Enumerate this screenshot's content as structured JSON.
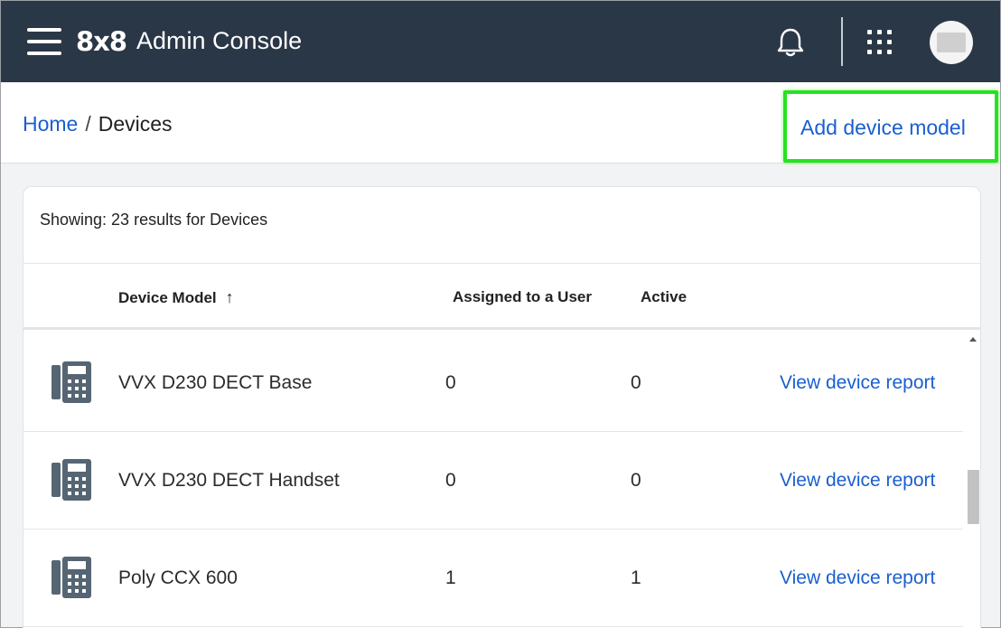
{
  "header": {
    "logo": "8x8",
    "title": "Admin Console",
    "icons": [
      "menu-icon",
      "bell-icon",
      "apps-grid-icon",
      "avatar"
    ]
  },
  "breadcrumb": {
    "home": "Home",
    "separator": "/",
    "current": "Devices"
  },
  "actions": {
    "add_device_model": "Add device model"
  },
  "results": {
    "showing": "Showing: 23 results for Devices"
  },
  "table": {
    "columns": {
      "device_model": "Device Model",
      "sort_indicator": "↑",
      "assigned": "Assigned to a User",
      "active": "Active"
    },
    "rows": [
      {
        "model": "VVX D230 DECT Base",
        "assigned": "0",
        "active": "0",
        "action": "View device report"
      },
      {
        "model": "VVX D230 DECT Handset",
        "assigned": "0",
        "active": "0",
        "action": "View device report"
      },
      {
        "model": "Poly CCX 600",
        "assigned": "1",
        "active": "1",
        "action": "View device report"
      }
    ]
  },
  "colors": {
    "topbar": "#2a3747",
    "link": "#1a5fd0",
    "highlight": "#27e21f"
  }
}
